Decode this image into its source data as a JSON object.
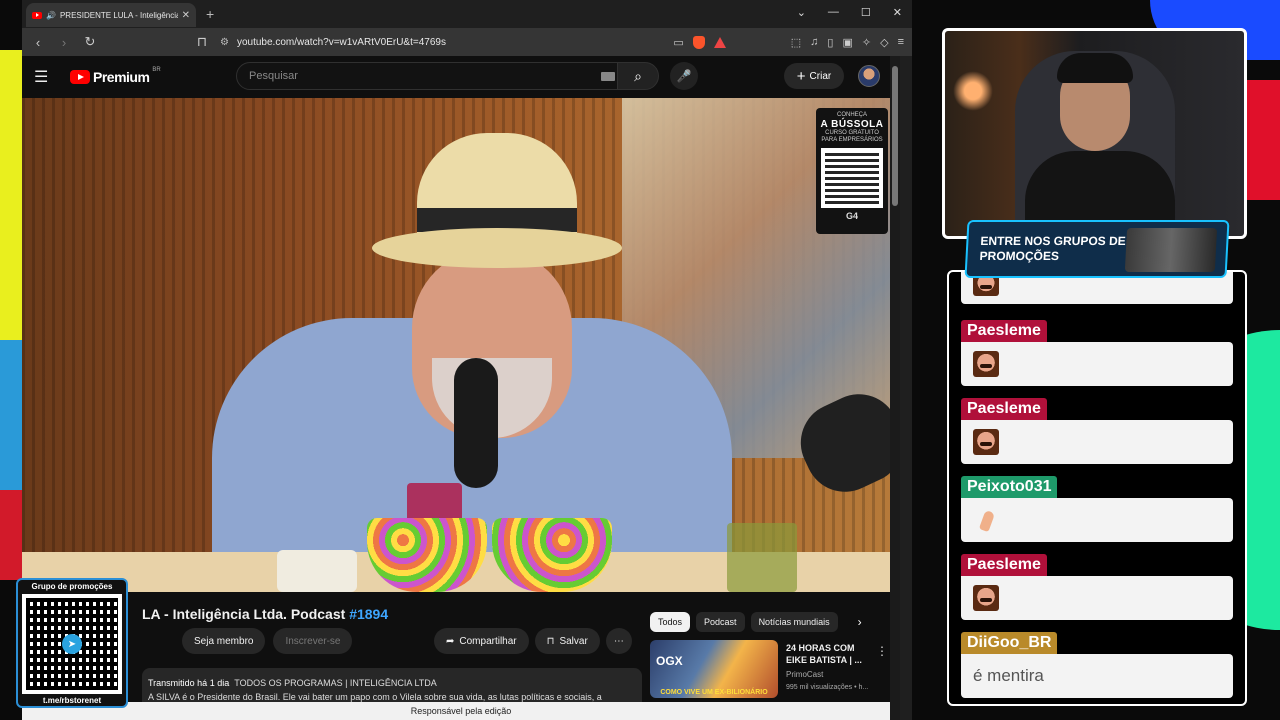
{
  "browser": {
    "tab_title": "PRESIDENTE LULA - Inteligência Ltd...",
    "url": "youtube.com/watch?v=w1vARtV0ErU&t=4769s"
  },
  "youtube": {
    "logo_text": "Premium",
    "logo_region": "BR",
    "search_placeholder": "Pesquisar",
    "create_label": "Criar",
    "video_title_main": "LA - Inteligência Ltda. Podcast ",
    "video_title_episode": "#1894",
    "join_label": "Seja membro",
    "subscribe_label": "Inscrever-se",
    "share_label": "Compartilhar",
    "save_label": "Salvar",
    "desc_meta": "Transmitido há 1 dia",
    "desc_tags": "TODOS OS PROGRAMAS | INTELIGÊNCIA LTDA",
    "desc_body": "A SILVA é o Presidente do Brasil. Ele vai bater um papo com o Vilela sobre sua vida, as lutas políticas e sociais, a",
    "chips": [
      "Todos",
      "Podcast",
      "Notícias mundiais"
    ],
    "rec": {
      "title": "24 HORAS COM EIKE BATISTA | ...",
      "channel": "PrimoCast",
      "views": "995 mil visualizações • h...",
      "thumb_caption": "COMO VIVE UM EX-BILIONÁRIO",
      "thumb_brand": "OGX"
    },
    "ad": {
      "line1": "CONHEÇA",
      "line2": "A BÚSSOLA",
      "line3": "CURSO GRATUITO",
      "line4": "PARA EMPRESÁRIOS",
      "brand": "G4"
    },
    "footer_notice": "Responsável pela edição"
  },
  "stream": {
    "promo_header": "Grupo de promoções",
    "promo_link": "t.me/rbstorenet",
    "banner_text": "ENTRE NOS GRUPOS DE PROMOÇÕES",
    "chat": [
      {
        "user": "Paesleme",
        "color": "#b0103a",
        "content": "",
        "emote": "face"
      },
      {
        "user": "Paesleme",
        "color": "#b0103a",
        "content": "",
        "emote": "face"
      },
      {
        "user": "Peixoto031",
        "color": "#1e9a6a",
        "content": "",
        "emote": "hand"
      },
      {
        "user": "Paesleme",
        "color": "#b0103a",
        "content": "",
        "emote": "face"
      },
      {
        "user": "DiiGoo_BR",
        "color": "#b98a2a",
        "content": "é mentira",
        "emote": ""
      }
    ]
  }
}
